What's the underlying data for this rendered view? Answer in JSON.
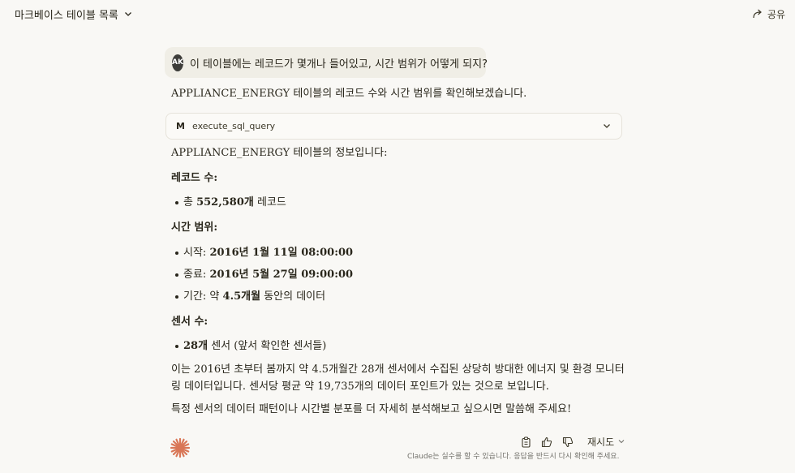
{
  "header": {
    "title": "마크베이스 테이블 목록",
    "share_label": "공유"
  },
  "user_message": {
    "avatar_initials": "AK",
    "text": "이 테이블에는 레코드가 몇개나 들어있고, 시간 범위가 어떻게 되지?"
  },
  "assistant": {
    "intro": "APPLIANCE_ENERGY 테이블의 레코드 수와 시간 범위를 확인해보겠습니다.",
    "tool_call": {
      "icon_letter": "M",
      "name": "execute_sql_query"
    },
    "info_line": "APPLIANCE_ENERGY 테이블의 정보입니다:",
    "records_heading": "레코드 수:",
    "records_item": {
      "prefix": "총 ",
      "bold": "552,580개",
      "suffix": " 레코드"
    },
    "time_heading": "시간 범위:",
    "time_items": [
      {
        "prefix": "시작: ",
        "bold": "2016년 1월 11일 08:00:00",
        "suffix": ""
      },
      {
        "prefix": "종료: ",
        "bold": "2016년 5월 27일 09:00:00",
        "suffix": ""
      },
      {
        "prefix": "기간: 약 ",
        "bold": "4.5개월",
        "suffix": " 동안의 데이터"
      }
    ],
    "sensor_heading": "센서 수:",
    "sensor_item": {
      "prefix": "",
      "bold": "28개",
      "suffix": " 센서 (앞서 확인한 센서들)"
    },
    "summary_line1": "이는 2016년 초부터 봄까지 약 4.5개월간 28개 센서에서 수집된 상당히 방대한 에너지 및 환경 모니터",
    "summary_line2": "링 데이터입니다. 센서당 평균 약 19,735개의 데이터 포인트가 있는 것으로 보입니다.",
    "closing": "특정 센서의 데이터 패턴이나 시간별 분포를 더 자세히 분석해보고 싶으시면 말씀해 주세요!"
  },
  "footer": {
    "retry_label": "재시도",
    "disclaimer": "Claude는 실수를 할 수 있습니다. 응답을 반드시 다시 확인해 주세요."
  },
  "colors": {
    "background": "#f9f8f5",
    "user_bubble": "#f0eee6",
    "avatar": "#3d3d3a",
    "claude_orange": "#d97757"
  }
}
